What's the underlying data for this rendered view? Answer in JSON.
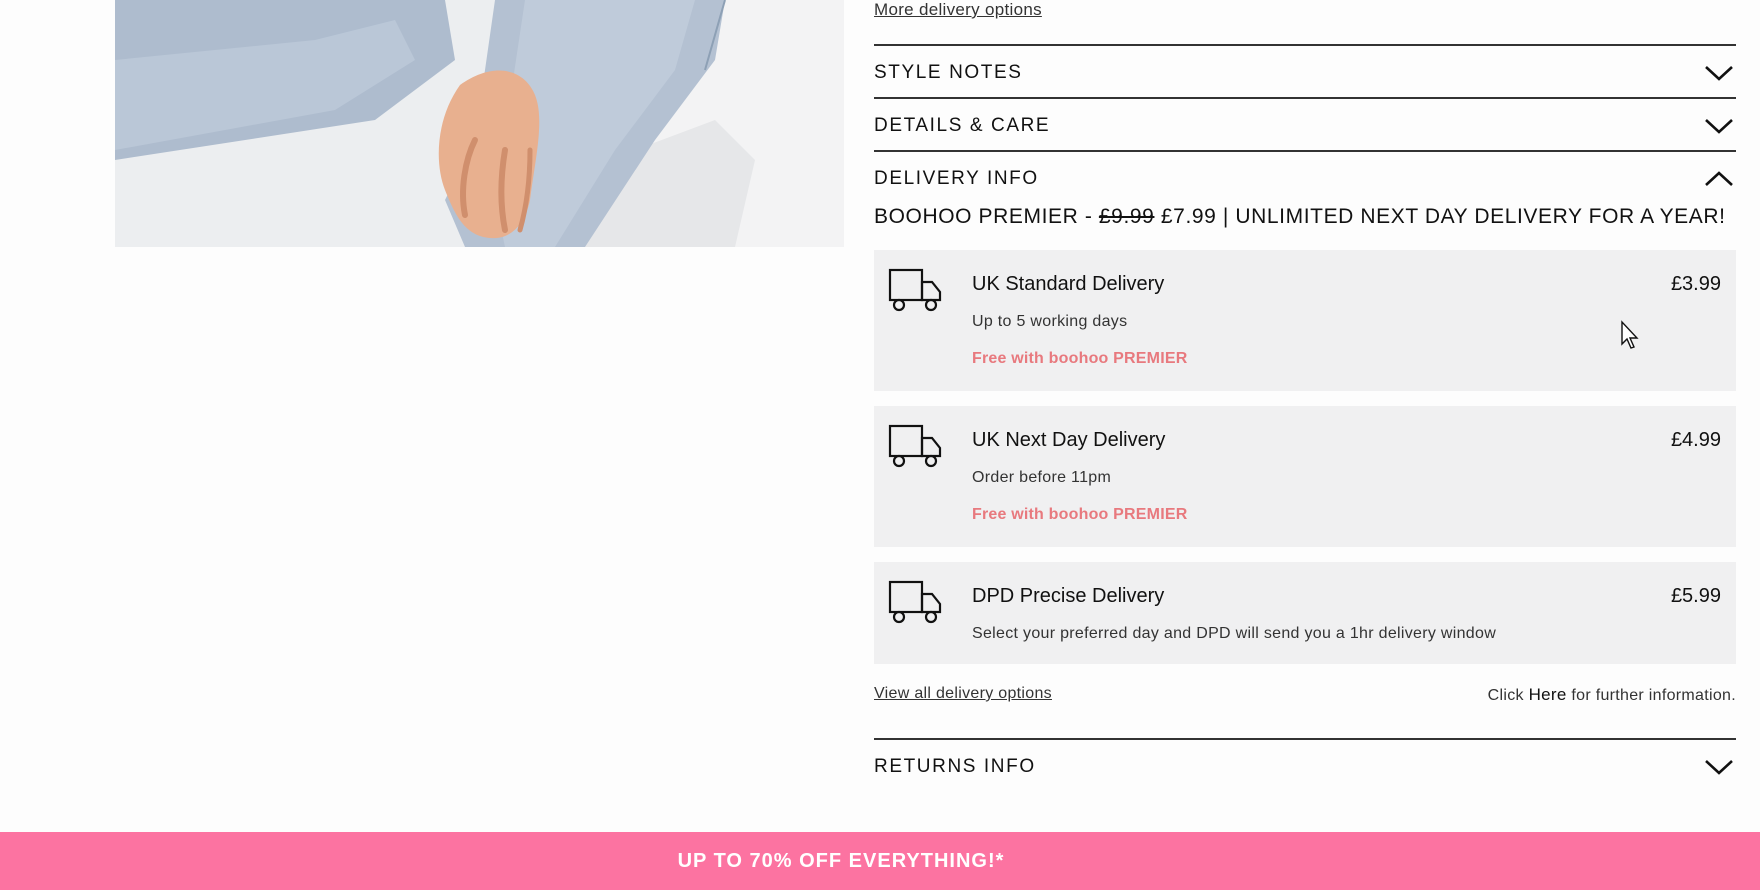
{
  "links": {
    "more_delivery": "More delivery options",
    "view_all": "View all delivery options"
  },
  "accordion": {
    "style_notes": "STYLE NOTES",
    "details_care": "DETAILS & CARE",
    "delivery_info": "DELIVERY INFO",
    "returns_info": "RETURNS INFO"
  },
  "premier": {
    "prefix": "BOOHOO PREMIER - ",
    "old_price": "£9.99",
    "new_price": "£7.99",
    "suffix": " | UNLIMITED NEXT DAY DELIVERY FOR A YEAR!"
  },
  "delivery_options": [
    {
      "title": "UK Standard Delivery",
      "price": "£3.99",
      "sub": "Up to 5 working days",
      "free": "Free with boohoo PREMIER"
    },
    {
      "title": "UK Next Day Delivery",
      "price": "£4.99",
      "sub": "Order before 11pm",
      "free": "Free with boohoo PREMIER"
    },
    {
      "title": "DPD Precise Delivery",
      "price": "£5.99",
      "sub": "Select your preferred day and DPD will send you a 1hr delivery window"
    }
  ],
  "further": {
    "prefix": "Click ",
    "here": "Here",
    "suffix": " for further information."
  },
  "promo": {
    "text": "UP TO 70% OFF EVERYTHING!*"
  },
  "icons": {
    "chevron_down": "chevron-down-icon",
    "chevron_up": "chevron-up-icon",
    "truck": "truck-icon"
  },
  "colors": {
    "promo_bar": "#fc73a1",
    "free_text": "#e8797e",
    "card_bg": "#f0f0f1"
  }
}
